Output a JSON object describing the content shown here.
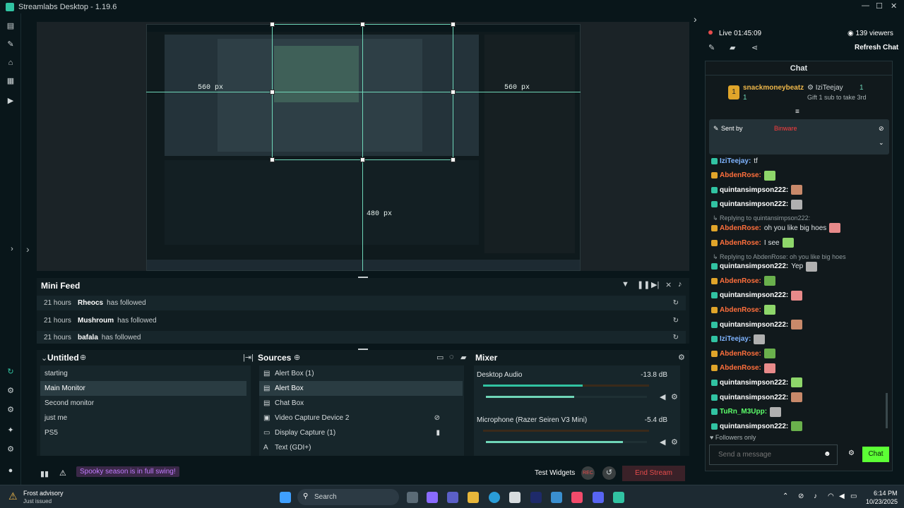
{
  "window": {
    "title": "Streamlabs Desktop - 1.19.6"
  },
  "preview": {
    "dim_width": "560 px",
    "dim_height": "480 px",
    "dim_width_inner": "560 px"
  },
  "mini_feed": {
    "title": "Mini Feed",
    "rows": [
      {
        "time": "21 hours",
        "name": "Rheocs",
        "event": "has followed"
      },
      {
        "time": "21 hours",
        "name": "Mushroum",
        "event": "has followed"
      },
      {
        "time": "21 hours",
        "name": "bafala",
        "event": "has followed"
      }
    ]
  },
  "scenes": {
    "title": "Untitled",
    "items": [
      "starting",
      "Main Monitor",
      "Second monitor",
      "just me",
      "PS5"
    ],
    "selected": "Main Monitor"
  },
  "sources": {
    "title": "Sources",
    "items": [
      {
        "icon": "stack-icon",
        "label": "Alert Box (1)"
      },
      {
        "icon": "stack-icon",
        "label": "Alert Box"
      },
      {
        "icon": "stack-icon",
        "label": "Chat Box"
      },
      {
        "icon": "camera-icon",
        "label": "Video Capture Device 2"
      },
      {
        "icon": "monitor-icon",
        "label": "Display Capture (1)"
      },
      {
        "icon": "text-icon",
        "label": "Text (GDI+)"
      }
    ]
  },
  "mixer": {
    "title": "Mixer",
    "channels": [
      {
        "name": "Desktop Audio",
        "db": "-13.8 dB",
        "volume": 0.55
      },
      {
        "name": "Microphone (Razer Seiren V3 Mini)",
        "db": "-5.4 dB",
        "volume": 0.85
      }
    ]
  },
  "footer": {
    "notice": "Spooky season is in full swing!",
    "test_widgets": "Test Widgets",
    "rec_label": "REC",
    "end_stream": "End Stream"
  },
  "stream": {
    "live_label": "Live",
    "live_time": "01:45:09",
    "viewers": "139 viewers",
    "refresh_chat": "Refresh Chat"
  },
  "chat": {
    "title": "Chat",
    "top_gifter": {
      "name": "snackmoneybeatz",
      "count": "1",
      "gifted_to": "IziTeejay",
      "gift_count": "1",
      "gift_text": "Gift 1 sub to take 3rd"
    },
    "pinned": {
      "sent_by": "Sent by",
      "user": "Binware"
    },
    "messages": [
      {
        "user": "IziTeejay",
        "text": "tf",
        "color": "#7fb4ff"
      },
      {
        "user": "AbdenRose",
        "text": "",
        "color": "#ff6f3c"
      },
      {
        "user": "quintansimpson222",
        "text": "",
        "color": "#ffffff"
      },
      {
        "user": "quintansimpson222",
        "text": "",
        "color": "#ffffff"
      },
      {
        "reply": "Replying to quintansimpson222:"
      },
      {
        "user": "AbdenRose",
        "text": "oh you like big hoes",
        "color": "#ff6f3c"
      },
      {
        "user": "AbdenRose",
        "text": "I see",
        "color": "#ff6f3c"
      },
      {
        "reply": "Replying to AbdenRose: oh you like big hoes"
      },
      {
        "user": "quintansimpson222",
        "text": "Yep",
        "color": "#ffffff"
      },
      {
        "user": "AbdenRose",
        "text": "",
        "color": "#ff6f3c"
      },
      {
        "user": "quintansimpson222",
        "text": "",
        "color": "#ffffff"
      },
      {
        "user": "AbdenRose",
        "text": "",
        "color": "#ff6f3c"
      },
      {
        "user": "quintansimpson222",
        "text": "",
        "color": "#ffffff"
      },
      {
        "user": "IziTeejay",
        "text": "",
        "color": "#7fb4ff"
      },
      {
        "user": "AbdenRose",
        "text": "",
        "color": "#ff6f3c"
      },
      {
        "user": "AbdenRose",
        "text": "",
        "color": "#ff6f3c"
      },
      {
        "user": "quintansimpson222",
        "text": "",
        "color": "#ffffff"
      },
      {
        "user": "quintansimpson222",
        "text": "",
        "color": "#ffffff"
      },
      {
        "user": "TuRn_M3Upp",
        "text": "",
        "color": "#5cff6a"
      },
      {
        "user": "quintansimpson222",
        "text": "",
        "color": "#ffffff"
      }
    ],
    "followers_only": "Followers only",
    "input_placeholder": "Send a message",
    "send_label": "Chat"
  },
  "taskbar": {
    "weather_title": "Frost advisory",
    "weather_sub": "Just issued",
    "search_placeholder": "Search",
    "time": "6:14 PM",
    "date": "10/23/2025"
  },
  "colors": {
    "accent": "#31c3a2",
    "end_stream": "#e74c4c",
    "chat_button": "#5cff35"
  }
}
